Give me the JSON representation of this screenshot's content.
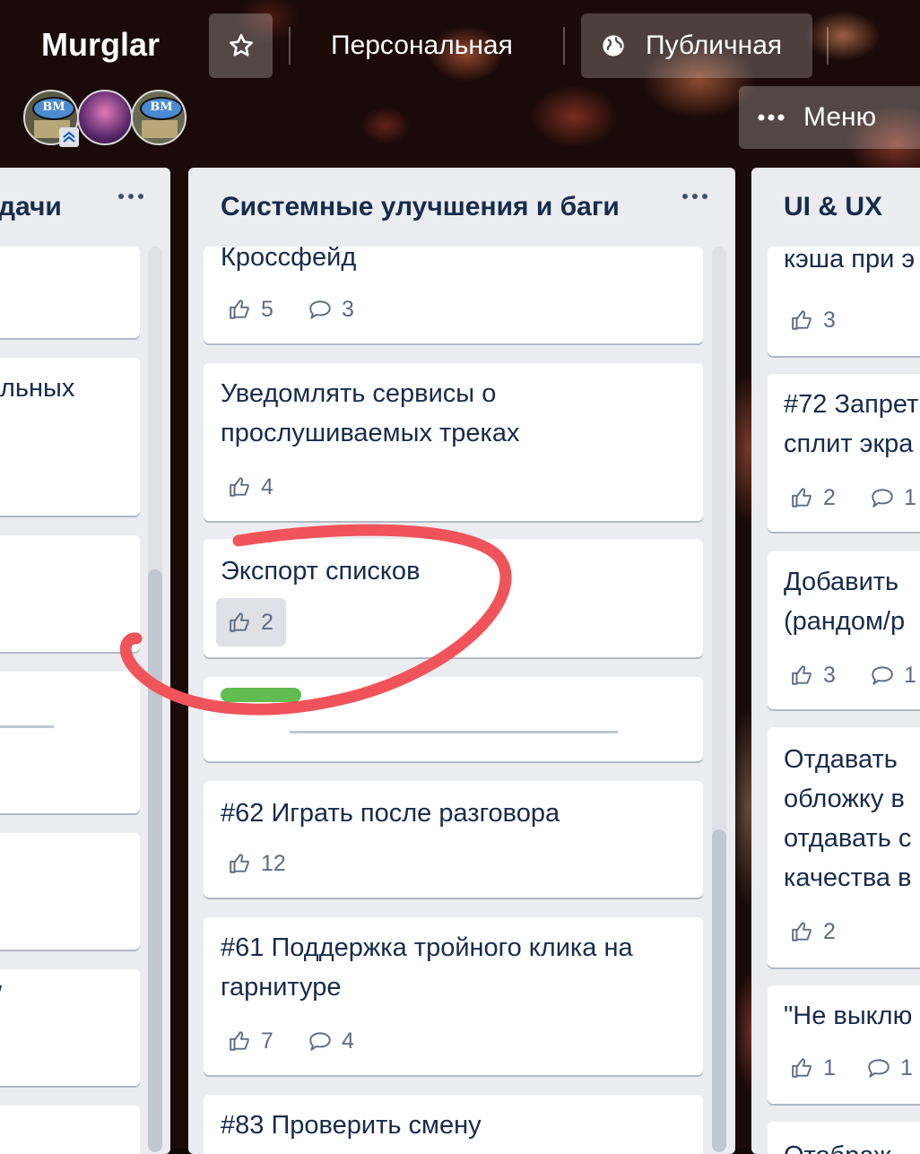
{
  "header": {
    "title": "Murglar",
    "visibility_personal": "Персональная",
    "visibility_public": "Публичная",
    "menu_label": "Меню",
    "avatars": [
      {
        "initials": "BM"
      },
      {
        "initials": ""
      },
      {
        "initials": "BM"
      }
    ]
  },
  "lists": [
    {
      "title": "дачи",
      "cards": [
        {
          "text": ""
        },
        {
          "text": "льных"
        },
        {
          "text": ""
        },
        {
          "text": ""
        },
        {
          "text": ""
        },
        {
          "text": "/"
        },
        {
          "text": ""
        }
      ]
    },
    {
      "title": "Системные улучшения и баги",
      "cards": [
        {
          "text": "Кроссфейд",
          "likes": "5",
          "comments": "3"
        },
        {
          "text": "Уведомлять сервисы о\nпрослушиваемых треках",
          "likes": "4"
        },
        {
          "text": "Экспорт списков",
          "likes": "2"
        },
        {
          "text": "",
          "label_color": "#61bd4f"
        },
        {
          "text": "#62 Играть после разговора",
          "likes": "12"
        },
        {
          "text": "#61 Поддержка тройного клика на\nгарнитуре",
          "likes": "7",
          "comments": "4"
        },
        {
          "text": "#83 Проверить смену"
        }
      ]
    },
    {
      "title": "UI & UX",
      "cards": [
        {
          "text": "кэша при э",
          "likes": "3"
        },
        {
          "text": "#72 Запрет\nсплит экра",
          "likes": "2",
          "comments": "1"
        },
        {
          "text": "Добавить\n(рандом/р",
          "likes": "3",
          "comments": "1"
        },
        {
          "text": "Отдавать\nобложку в\nотдавать с\nкачества в",
          "likes": "2"
        },
        {
          "text": "\"Не выклю",
          "likes": "1",
          "comments": "1"
        },
        {
          "text": "Отображ"
        }
      ]
    }
  ],
  "colors": {
    "annotation": "#f0545a",
    "label_green": "#61bd4f"
  }
}
